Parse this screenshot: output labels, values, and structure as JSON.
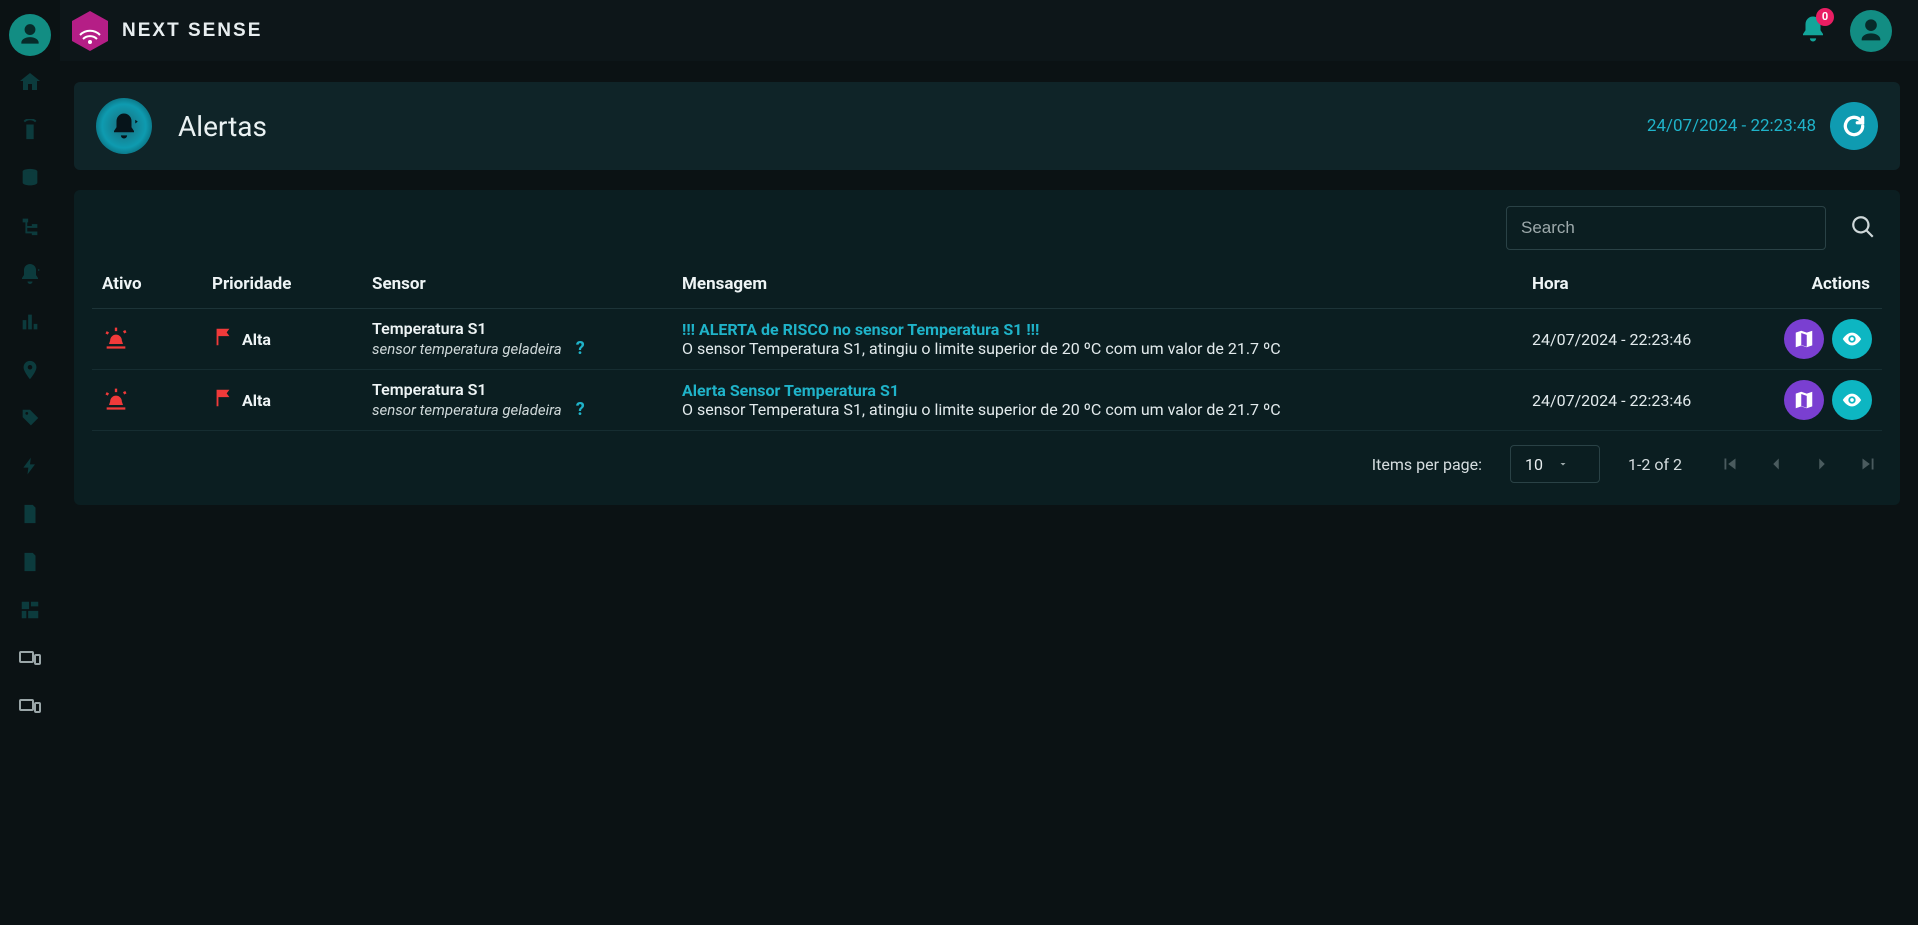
{
  "brand": {
    "name": "NEXT SENSE"
  },
  "topbar": {
    "notif_count": "0"
  },
  "header": {
    "title": "Alertas",
    "timestamp": "24/07/2024 - 22:23:48"
  },
  "search": {
    "placeholder": "Search"
  },
  "columns": {
    "ativo": "Ativo",
    "prioridade": "Prioridade",
    "sensor": "Sensor",
    "mensagem": "Mensagem",
    "hora": "Hora",
    "actions": "Actions"
  },
  "rows": [
    {
      "prioridade": "Alta",
      "sensor_name": "Temperatura S1",
      "sensor_sub": "sensor temperatura geladeira",
      "msg_title": "!!! ALERTA de RISCO no sensor Temperatura S1 !!!",
      "msg_body": "O sensor Temperatura S1, atingiu o limite superior de 20 ºC com um valor de 21.7 ºC",
      "hora": "24/07/2024 - 22:23:46"
    },
    {
      "prioridade": "Alta",
      "sensor_name": "Temperatura S1",
      "sensor_sub": "sensor temperatura geladeira",
      "msg_title": "Alerta Sensor Temperatura S1",
      "msg_body": "O sensor Temperatura S1, atingiu o limite superior de 20 ºC com um valor de 21.7 ºC",
      "hora": "24/07/2024 - 22:23:46"
    }
  ],
  "paginator": {
    "items_per_page_label": "Items per page:",
    "items_per_page_value": "10",
    "range": "1-2 of 2"
  },
  "icons": {
    "help": "?"
  }
}
